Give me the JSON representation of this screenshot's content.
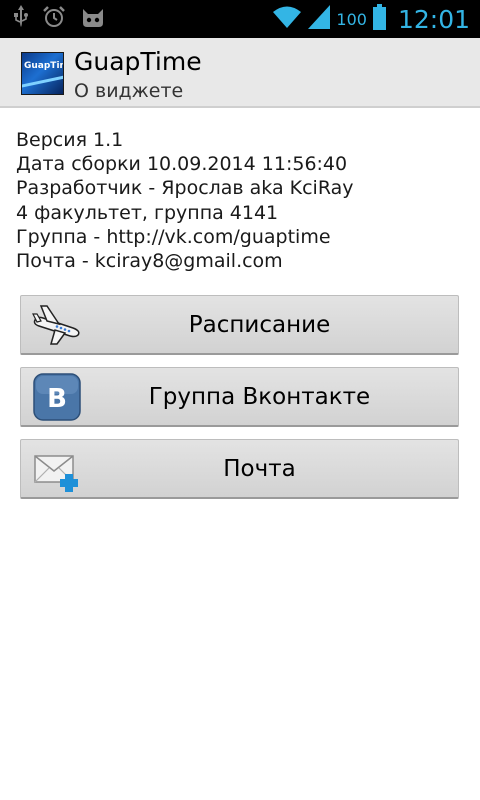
{
  "status_bar": {
    "battery": "100",
    "time": "12:01",
    "icons": [
      "usb-icon",
      "alarm-icon",
      "cyanogen-icon",
      "wifi-icon",
      "signal-icon",
      "battery-icon"
    ]
  },
  "action_bar": {
    "title": "GuapTime",
    "subtitle": "О виджете",
    "icon_text": "GuapTime"
  },
  "info": {
    "version": "Версия 1.1",
    "build_date": "Дата сборки 10.09.2014 11:56:40",
    "developer": "Разработчик - Ярослав aka KciRay",
    "faculty": "4 факультет, группа 4141",
    "group": "Группа - http://vk.com/guaptime",
    "email": "Почта - kciray8@gmail.com"
  },
  "buttons": {
    "schedule_label": "Расписание",
    "vk_label": "Группа Вконтакте",
    "mail_label": "Почта",
    "vk_icon_letter": "B"
  },
  "colors": {
    "status_accent": "#33b5e5",
    "vk_blue": "#4a76a8",
    "mail_plus": "#1e90d8"
  }
}
